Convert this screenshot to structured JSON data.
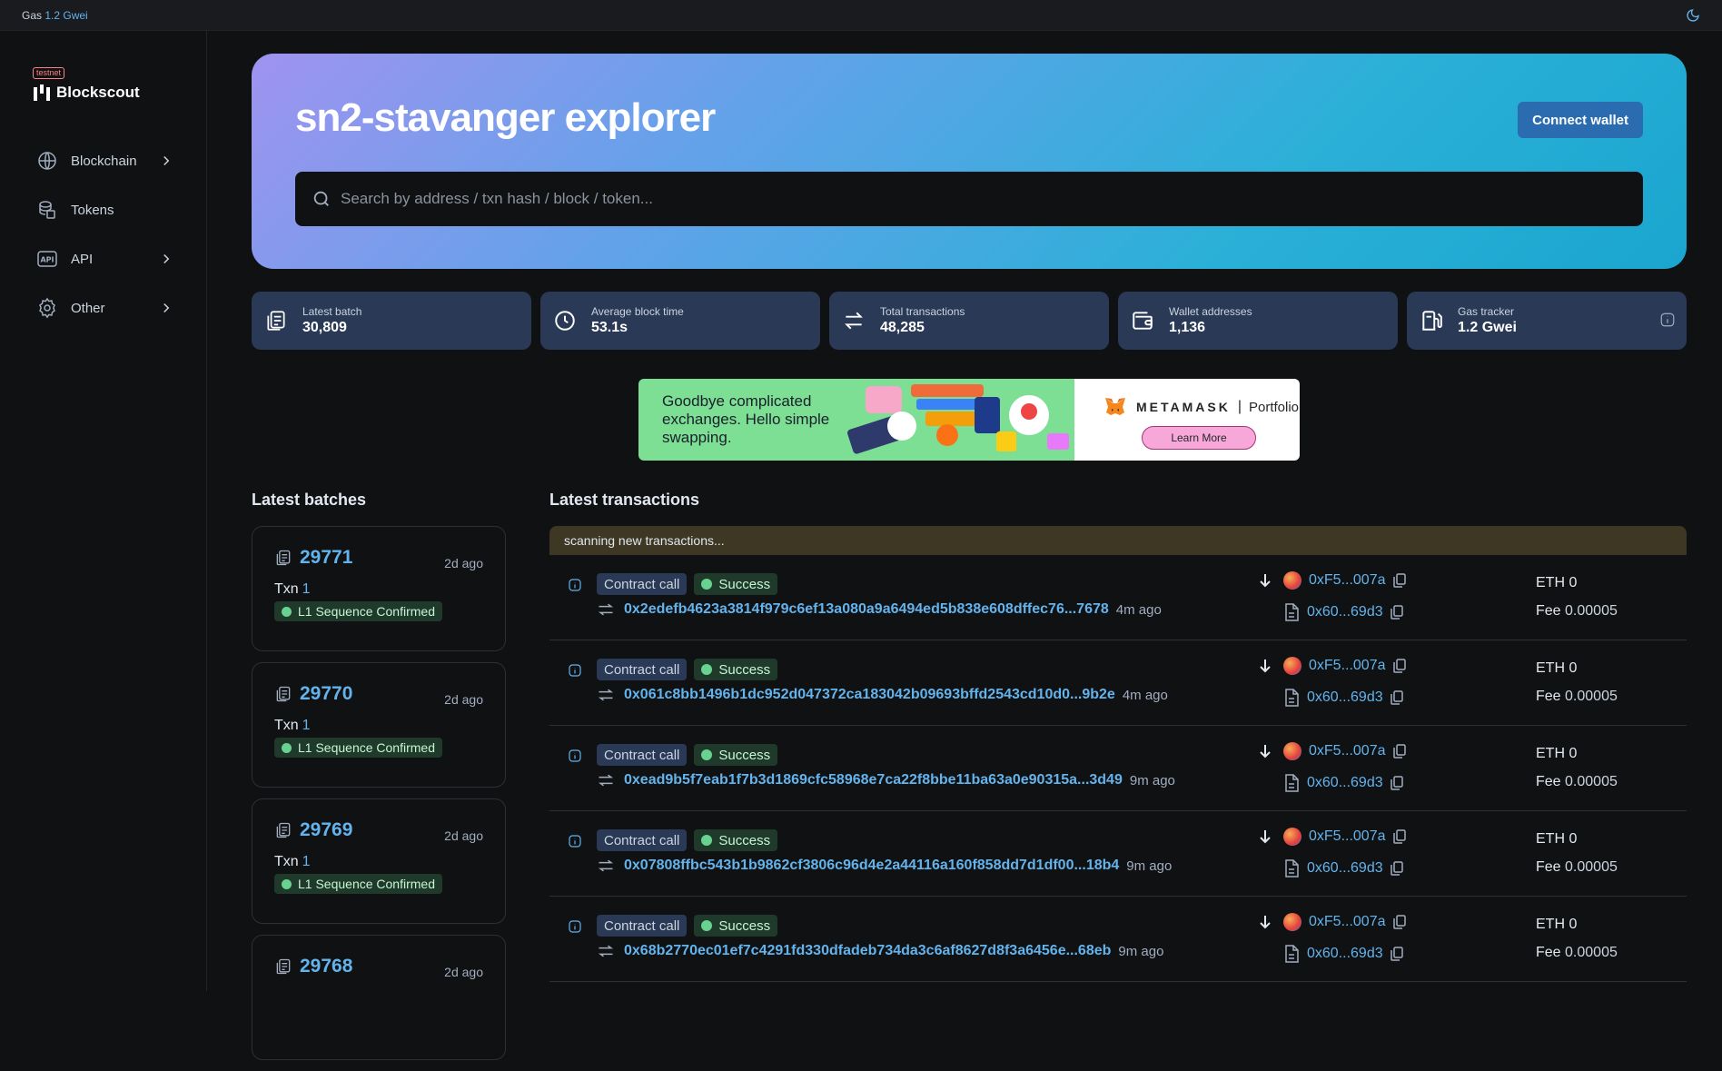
{
  "topbar": {
    "gas_prefix": "Gas",
    "gas_value": "1.2 Gwei"
  },
  "brand": {
    "badge": "testnet",
    "name": "Blockscout"
  },
  "nav": [
    {
      "label": "Blockchain",
      "icon": "globe-icon",
      "has_chevron": true
    },
    {
      "label": "Tokens",
      "icon": "coins-icon",
      "has_chevron": false
    },
    {
      "label": "API",
      "icon": "api-icon",
      "has_chevron": true
    },
    {
      "label": "Other",
      "icon": "gear-icon",
      "has_chevron": true
    }
  ],
  "hero": {
    "title": "sn2-stavanger explorer",
    "connect_label": "Connect wallet",
    "search_placeholder": "Search by address / txn hash / block / token..."
  },
  "stats": [
    {
      "label": "Latest batch",
      "value": "30,809",
      "icon": "document-icon"
    },
    {
      "label": "Average block time",
      "value": "53.1s",
      "icon": "clock-icon"
    },
    {
      "label": "Total transactions",
      "value": "48,285",
      "icon": "transfer-icon"
    },
    {
      "label": "Wallet addresses",
      "value": "1,136",
      "icon": "wallet-icon"
    },
    {
      "label": "Gas tracker",
      "value": "1.2 Gwei",
      "icon": "gas-pump-icon"
    }
  ],
  "ad": {
    "text": "Goodbye complicated exchanges. Hello simple swapping.",
    "brand": "METAMASK",
    "separator": "|",
    "product": "Portfolio",
    "cta": "Learn More"
  },
  "batches": {
    "title": "Latest batches",
    "txn_label": "Txn",
    "status": "L1 Sequence Confirmed",
    "items": [
      {
        "number": "29771",
        "age": "2d ago",
        "txn": "1"
      },
      {
        "number": "29770",
        "age": "2d ago",
        "txn": "1"
      },
      {
        "number": "29769",
        "age": "2d ago",
        "txn": "1"
      },
      {
        "number": "29768",
        "age": "2d ago",
        "txn": ""
      }
    ]
  },
  "transactions": {
    "title": "Latest transactions",
    "scanning": "scanning new transactions...",
    "type_label": "Contract call",
    "status_label": "Success",
    "from": "0xF5...007a",
    "to": "0x60...69d3",
    "value": "ETH 0",
    "fee_label": "Fee",
    "fee": "0.00005",
    "items": [
      {
        "hash": "0x2edefb4623a3814f979c6ef13a080a9a6494ed5b838e608dffec76...7678",
        "age": "4m ago"
      },
      {
        "hash": "0x061c8bb1496b1dc952d047372ca183042b09693bffd2543cd10d0...9b2e",
        "age": "4m ago"
      },
      {
        "hash": "0xead9b5f7eab1f7b3d1869cfc58968e7ca22f8bbe11ba63a0e90315a...3d49",
        "age": "9m ago"
      },
      {
        "hash": "0x07808ffbc543b1b9862cf3806c96d4e2a44116a160f858dd7d1df00...18b4",
        "age": "9m ago"
      },
      {
        "hash": "0x68b2770ec01ef7c4291fd330dfadeb734da3c6af8627d8f3a6456e...68eb",
        "age": "9m ago"
      }
    ]
  }
}
